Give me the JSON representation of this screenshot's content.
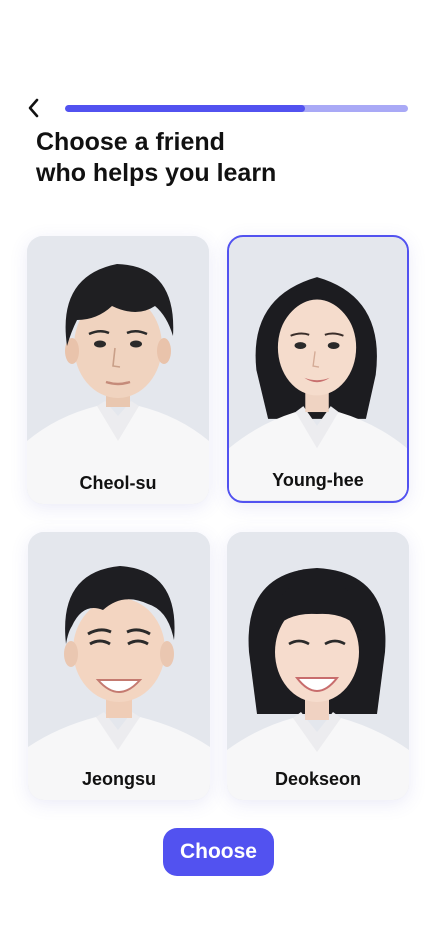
{
  "header": {
    "back_icon": "chevron-left-icon",
    "progress": 0.7,
    "colors": {
      "accent": "#5252f0",
      "track": "#a9a9f6"
    }
  },
  "title": {
    "line1": "Choose a friend",
    "line2": "who helps you learn"
  },
  "friends": [
    {
      "name": "Cheol-su",
      "selected": false
    },
    {
      "name": "Young-hee",
      "selected": true
    },
    {
      "name": "Jeongsu",
      "selected": false
    },
    {
      "name": "Deokseon",
      "selected": false
    }
  ],
  "action": {
    "choose_label": "Choose"
  }
}
